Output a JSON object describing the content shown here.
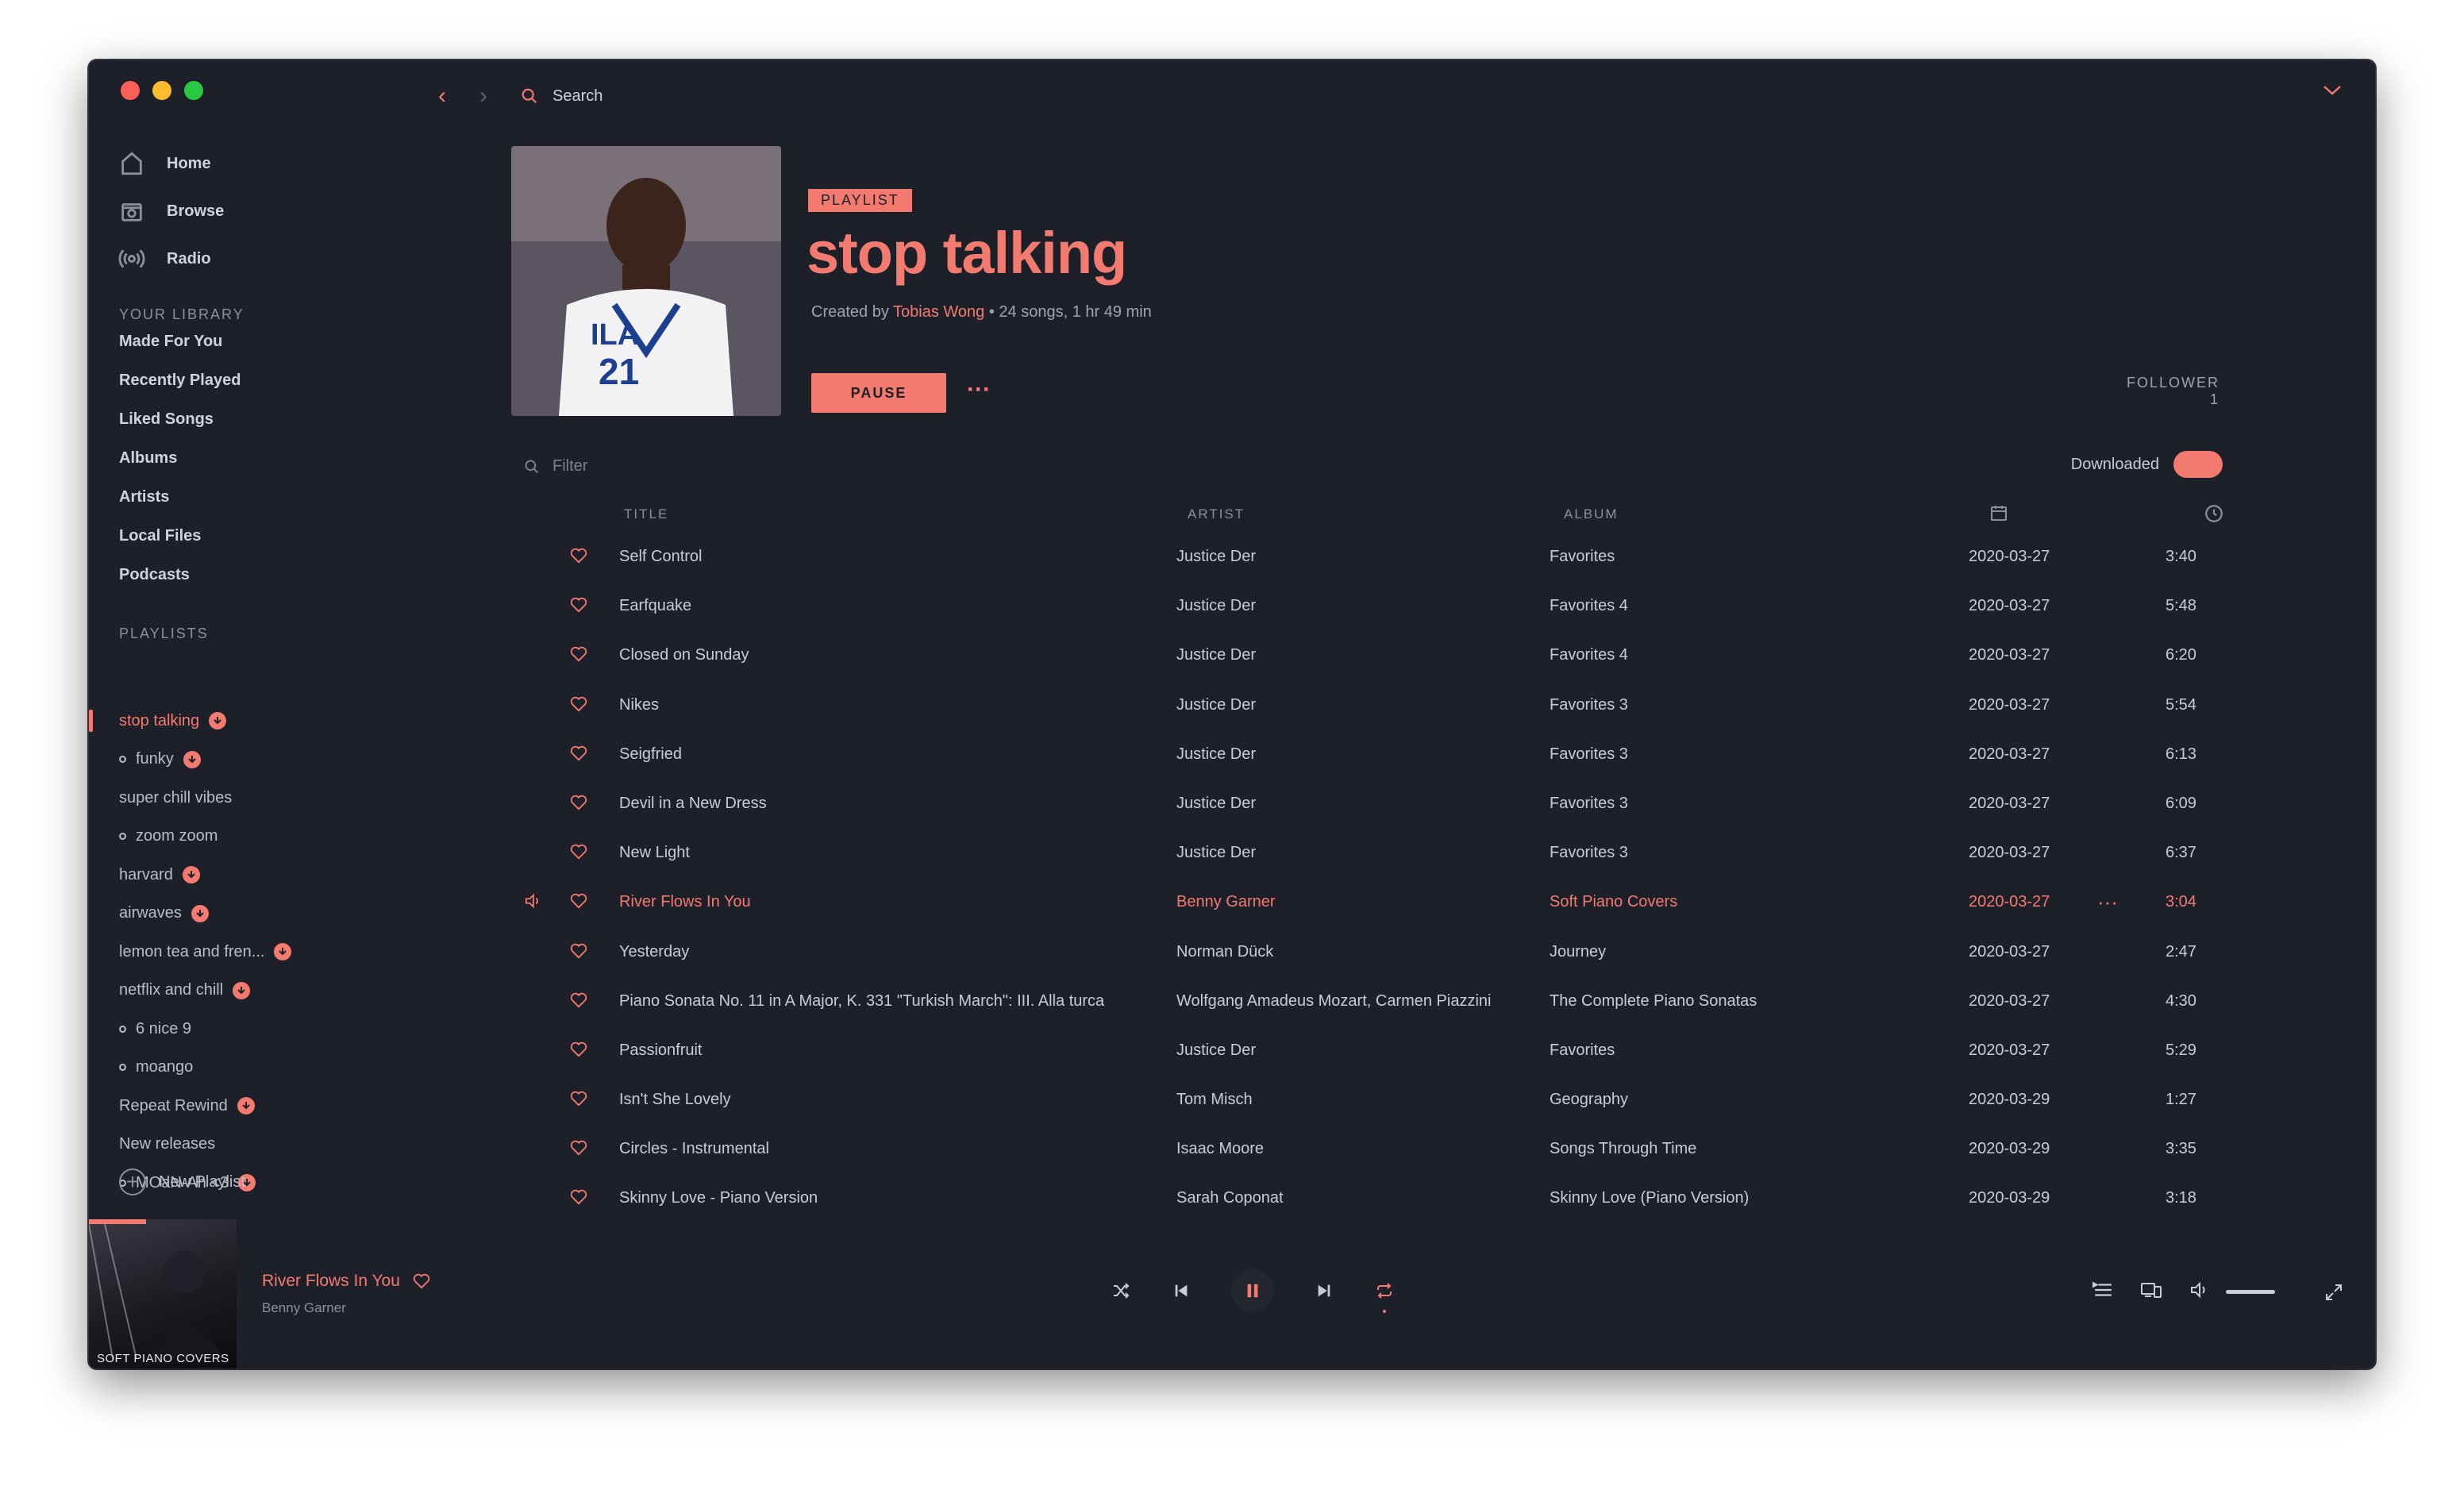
{
  "nav": [
    {
      "label": "Home",
      "icon": "home-icon"
    },
    {
      "label": "Browse",
      "icon": "browse-icon"
    },
    {
      "label": "Radio",
      "icon": "radio-icon"
    }
  ],
  "library": {
    "heading": "YOUR LIBRARY",
    "items": [
      "Made For You",
      "Recently Played",
      "Liked Songs",
      "Albums",
      "Artists",
      "Local Files",
      "Podcasts"
    ]
  },
  "playlists": {
    "heading": "PLAYLISTS",
    "items": [
      {
        "label": "stop talking",
        "downloaded": true,
        "active": true,
        "dot": false
      },
      {
        "label": "funky",
        "downloaded": true,
        "dot": true
      },
      {
        "label": "super chill vibes",
        "downloaded": false,
        "dot": false
      },
      {
        "label": "zoom zoom",
        "downloaded": false,
        "dot": true
      },
      {
        "label": "harvard",
        "downloaded": true,
        "dot": false
      },
      {
        "label": "airwaves",
        "downloaded": true,
        "dot": false
      },
      {
        "label": "lemon tea and fren...",
        "downloaded": true,
        "dot": false
      },
      {
        "label": "netflix and chill",
        "downloaded": true,
        "dot": false
      },
      {
        "label": "6 nice 9",
        "downloaded": false,
        "dot": true
      },
      {
        "label": "moango",
        "downloaded": false,
        "dot": true
      },
      {
        "label": "Repeat Rewind",
        "downloaded": true,
        "dot": false
      },
      {
        "label": "New releases",
        "downloaded": false,
        "dot": false
      },
      {
        "label": "MOaN-Ah <3",
        "downloaded": true,
        "dot": true
      }
    ],
    "new_label": "New Playlist"
  },
  "topbar": {
    "search_label": "Search"
  },
  "header": {
    "tag": "PLAYLIST",
    "title": "stop talking",
    "created_by_prefix": "Created by",
    "creator": "Tobias Wong",
    "meta_suffix": " • 24 songs, 1 hr 49 min",
    "pause_label": "PAUSE",
    "more_label": "···",
    "follower_label": "FOLLOWER",
    "follower_count": "1"
  },
  "filter": {
    "placeholder": "Filter",
    "downloaded_label": "Downloaded"
  },
  "table": {
    "headers": {
      "title": "TITLE",
      "artist": "ARTIST",
      "album": "ALBUM"
    },
    "rows": [
      {
        "title": "Self Control",
        "artist": "Justice Der",
        "album": "Favorites",
        "date": "2020-03-27",
        "duration": "3:40"
      },
      {
        "title": "Earfquake",
        "artist": "Justice Der",
        "album": "Favorites 4",
        "date": "2020-03-27",
        "duration": "5:48"
      },
      {
        "title": "Closed on Sunday",
        "artist": "Justice Der",
        "album": "Favorites 4",
        "date": "2020-03-27",
        "duration": "6:20"
      },
      {
        "title": "Nikes",
        "artist": "Justice Der",
        "album": "Favorites 3",
        "date": "2020-03-27",
        "duration": "5:54"
      },
      {
        "title": "Seigfried",
        "artist": "Justice Der",
        "album": "Favorites 3",
        "date": "2020-03-27",
        "duration": "6:13"
      },
      {
        "title": "Devil in a New Dress",
        "artist": "Justice Der",
        "album": "Favorites 3",
        "date": "2020-03-27",
        "duration": "6:09"
      },
      {
        "title": "New Light",
        "artist": "Justice Der",
        "album": "Favorites 3",
        "date": "2020-03-27",
        "duration": "6:37"
      },
      {
        "title": "River Flows In You",
        "artist": "Benny Garner",
        "album": "Soft Piano Covers",
        "date": "2020-03-27",
        "duration": "3:04",
        "playing": true
      },
      {
        "title": "Yesterday",
        "artist": "Norman Dück",
        "album": "Journey",
        "date": "2020-03-27",
        "duration": "2:47"
      },
      {
        "title": "Piano Sonata No. 11 in A Major, K. 331 \"Turkish March\": III. Alla turca",
        "artist": "Wolfgang Amadeus Mozart, Carmen Piazzini",
        "album": "The Complete Piano Sonatas",
        "date": "2020-03-27",
        "duration": "4:30"
      },
      {
        "title": "Passionfruit",
        "artist": "Justice Der",
        "album": "Favorites",
        "date": "2020-03-27",
        "duration": "5:29"
      },
      {
        "title": "Isn't She Lovely",
        "artist": "Tom Misch",
        "album": "Geography",
        "date": "2020-03-29",
        "duration": "1:27"
      },
      {
        "title": "Circles - Instrumental",
        "artist": "Isaac Moore",
        "album": "Songs Through Time",
        "date": "2020-03-29",
        "duration": "3:35"
      },
      {
        "title": "Skinny Love - Piano Version",
        "artist": "Sarah Coponat",
        "album": "Skinny Love (Piano Version)",
        "date": "2020-03-29",
        "duration": "3:18"
      }
    ]
  },
  "now_playing": {
    "title": "River Flows In You",
    "artist": "Benny Garner",
    "art_label": "SOFT PIANO COVERS",
    "volume": 1.0
  },
  "colors": {
    "accent": "#f37a6f",
    "background": "#1d2029",
    "text": "#c8ccd6",
    "muted": "#8b909c"
  }
}
